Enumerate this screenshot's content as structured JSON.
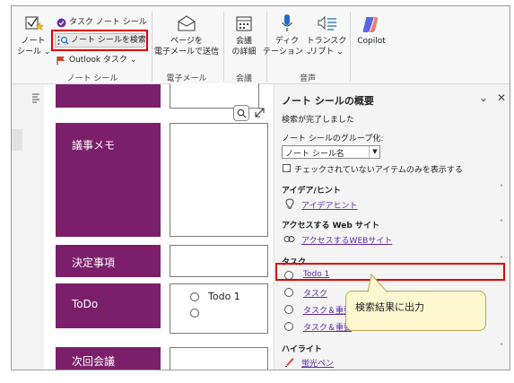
{
  "ribbon": {
    "notetags": {
      "tag_label": "ノート\nシール",
      "tag_sub": "⌄"
    },
    "task_tag": "タスク ノート シール",
    "find_tags": "ノート シールを検索",
    "outlook_task": "Outlook タスク ⌄",
    "group_notetags": "ノート シール",
    "email_page": "ページを\n電子メールで送信",
    "group_email": "電子メール",
    "meeting_details": "会議\nの詳細",
    "group_meeting": "会議",
    "dictate": "ディク\nテーション ⌄",
    "transcribe": "トランスク\nリプト ⌄",
    "group_voice": "音声",
    "copilot": "Copilot"
  },
  "page": {
    "minutes_label": "議事メモ",
    "decisions_label": "決定事項",
    "todo_label": "ToDo",
    "todo_item": "Todo 1",
    "next_meeting_label": "次回会議"
  },
  "pane": {
    "title": "ノート シールの概要",
    "status": "検索が完了しました",
    "group_by_label": "ノート シールのグループ化:",
    "group_by_value": "ノート シール名",
    "unchecked_only": "チェックされていないアイテムのみを表示する",
    "sections": [
      {
        "title": "アイデア/ヒント",
        "items": [
          "アイデアヒント"
        ],
        "icon": "lightbulb-icon"
      },
      {
        "title": "アクセスする Web サイト",
        "items": [
          "アクセスするWEBサイト"
        ],
        "icon": "link-icon"
      },
      {
        "title": "タスク",
        "items": [
          "Todo 1",
          "タスク",
          "タスク＆重要",
          "タスク＆重要"
        ],
        "icon": "radio-icon"
      },
      {
        "title": "ハイライト",
        "items": [
          "蛍光ペン"
        ],
        "icon": "highlighter-icon"
      }
    ],
    "callout": "検索結果に出力"
  },
  "colors": {
    "accent_purple": "#7b1f6a",
    "highlight_red": "#e00000",
    "link": "#5a2aa8"
  }
}
